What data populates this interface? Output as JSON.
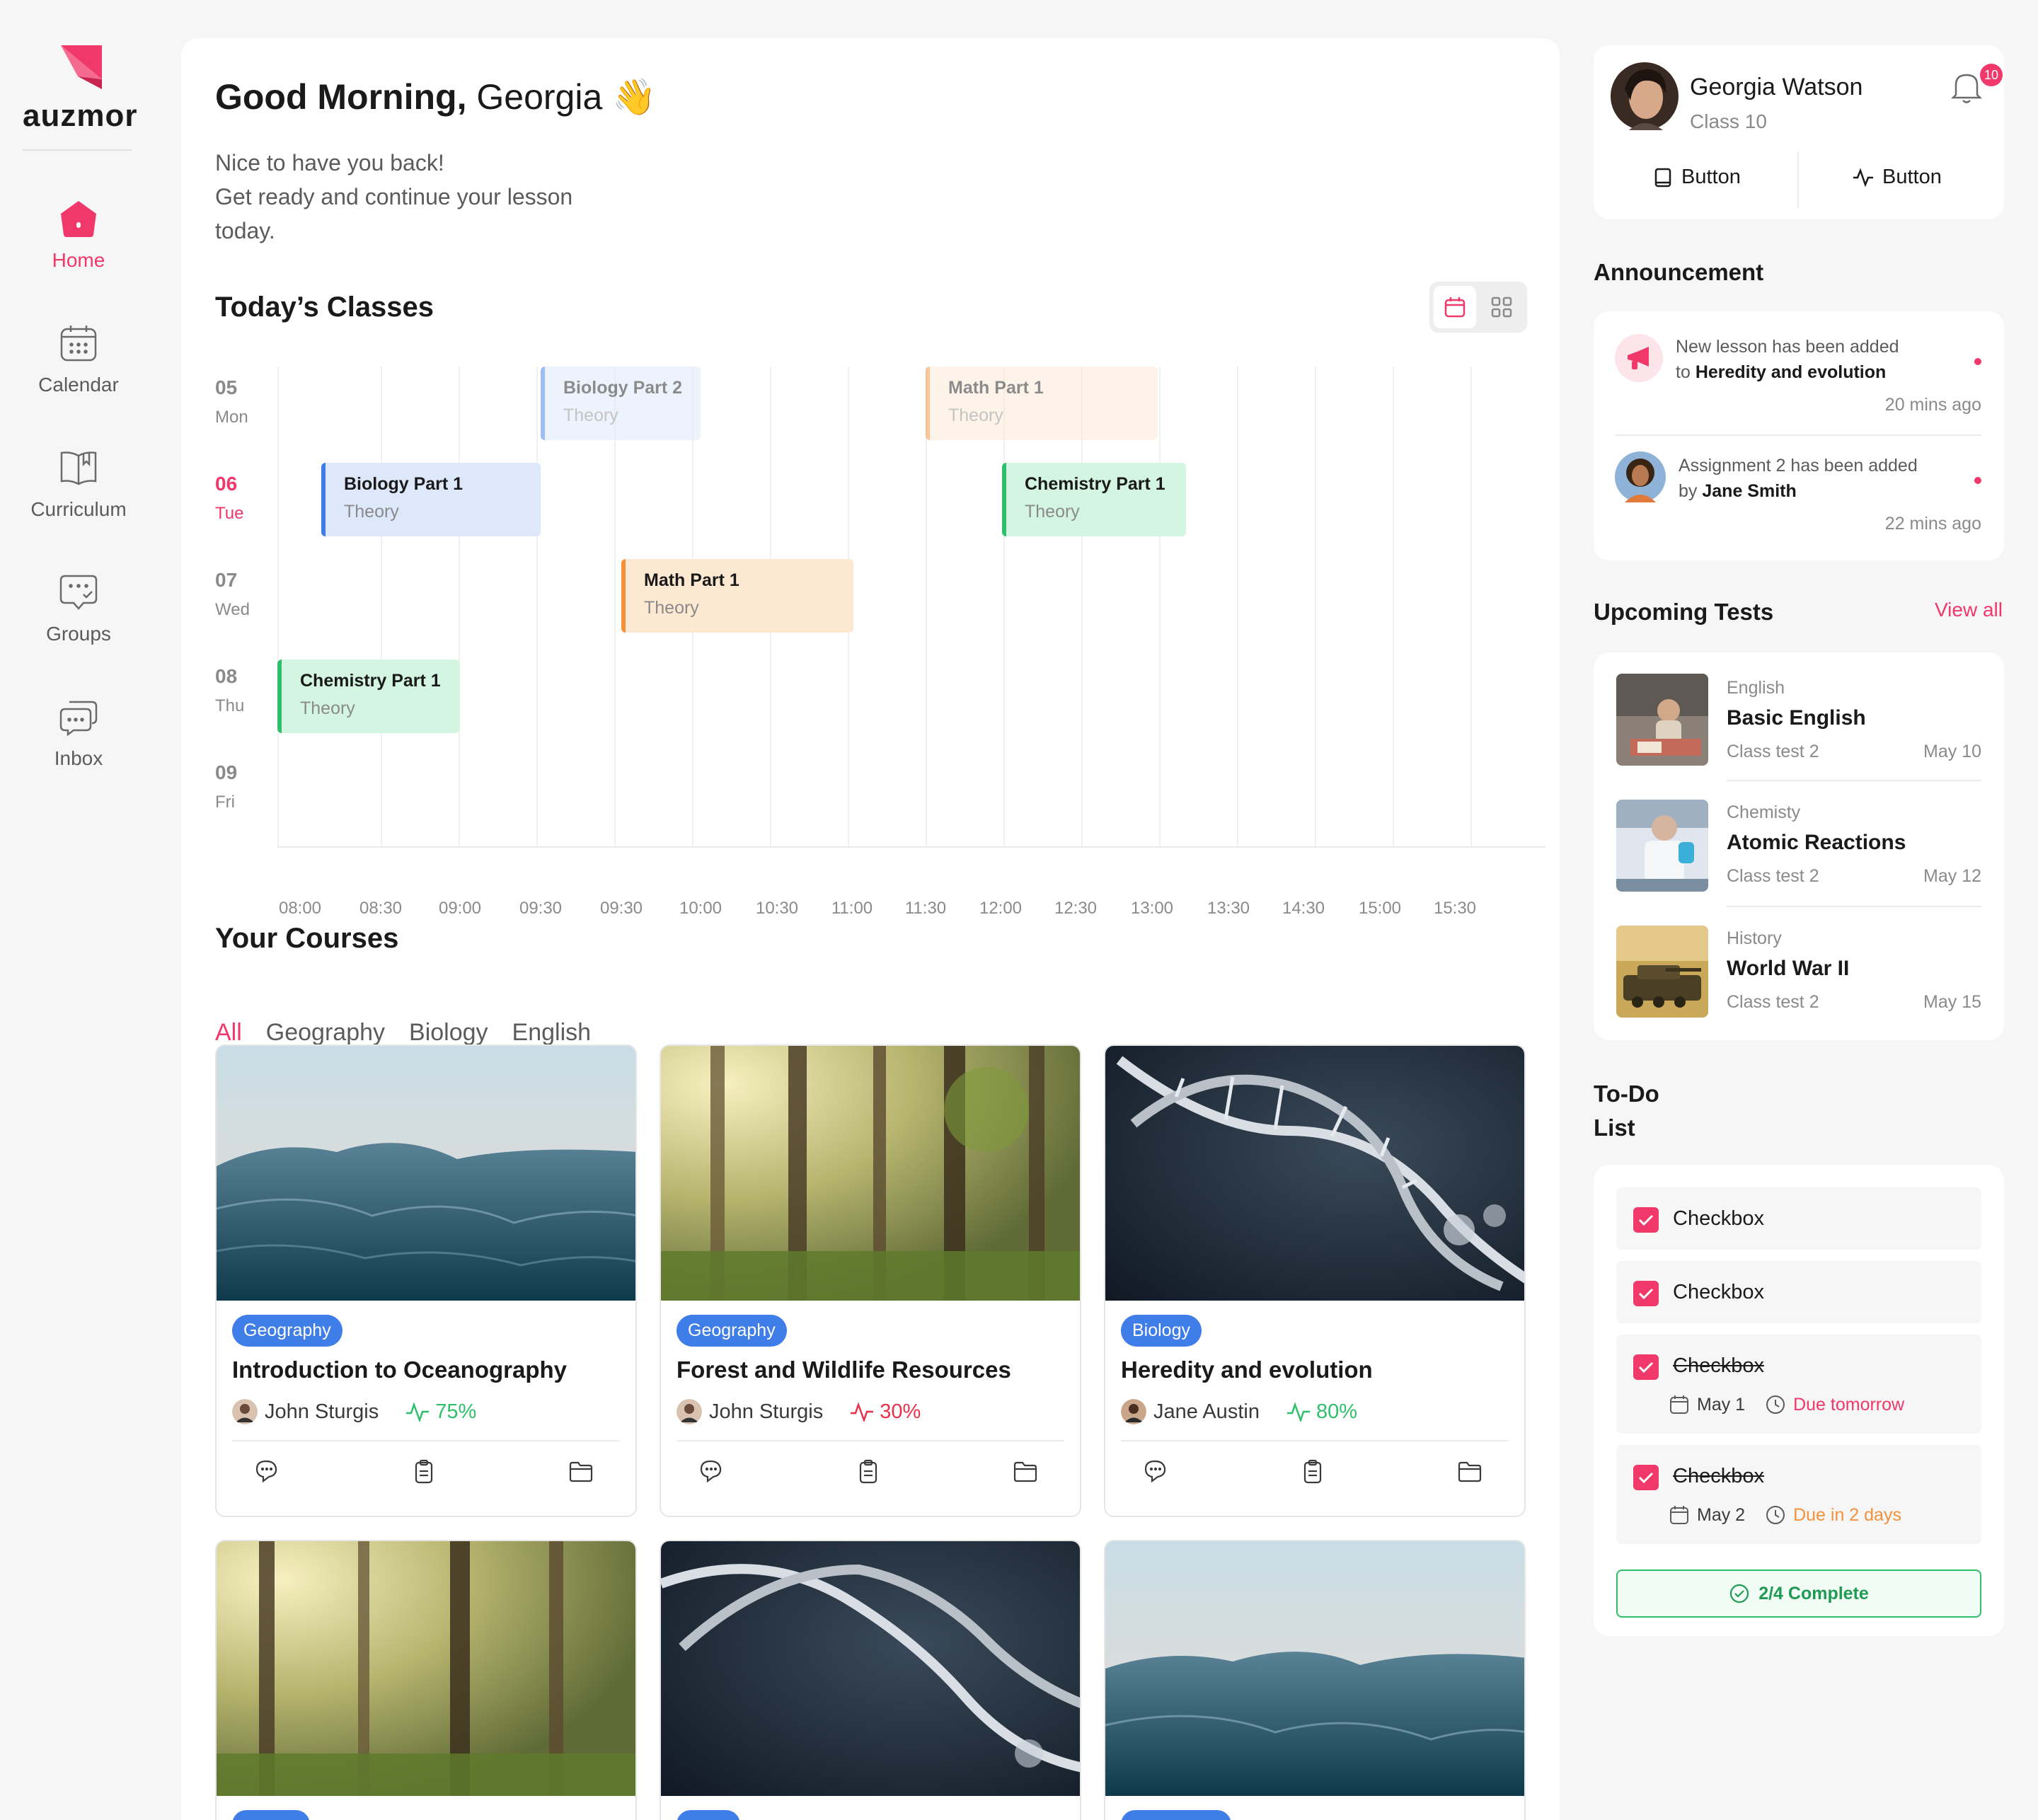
{
  "brand": {
    "name": "auzmor",
    "accent": "#f0386b"
  },
  "nav": [
    {
      "label": "Home",
      "icon": "home-icon",
      "active": true
    },
    {
      "label": "Calendar",
      "icon": "calendar-icon"
    },
    {
      "label": "Curriculum",
      "icon": "book-icon"
    },
    {
      "label": "Groups",
      "icon": "groups-icon"
    },
    {
      "label": "Inbox",
      "icon": "inbox-icon"
    }
  ],
  "greeting": {
    "prefix": "Good Morning,",
    "name": "Georgia",
    "emoji": "👋"
  },
  "subtitle": {
    "line1": "Nice to have you back!",
    "line2": "Get ready and continue your lesson today."
  },
  "today": {
    "title": "Today’s Classes",
    "days": [
      {
        "num": "05",
        "name": "Mon"
      },
      {
        "num": "06",
        "name": "Tue",
        "today": true
      },
      {
        "num": "07",
        "name": "Wed"
      },
      {
        "num": "08",
        "name": "Thu"
      },
      {
        "num": "09",
        "name": "Fri"
      }
    ],
    "times": [
      "08:00",
      "08:30",
      "09:00",
      "09:30",
      "09:30",
      "10:00",
      "10:30",
      "11:00",
      "11:30",
      "12:00",
      "12:30",
      "13:00",
      "13:30",
      "14:30",
      "15:00",
      "15:30"
    ],
    "events": [
      {
        "title": "Biology Part 2",
        "sub": "Theory",
        "color": "blue",
        "faded": true,
        "day": "Mon"
      },
      {
        "title": "Math Part 1",
        "sub": "Theory",
        "color": "orange",
        "faded": true,
        "day": "Mon"
      },
      {
        "title": "Biology Part 1",
        "sub": "Theory",
        "color": "blue",
        "day": "Tue"
      },
      {
        "title": "Chemistry Part 1",
        "sub": "Theory",
        "color": "green",
        "day": "Tue"
      },
      {
        "title": "Math Part 1",
        "sub": "Theory",
        "color": "orange",
        "day": "Wed"
      },
      {
        "title": "Chemistry Part 1",
        "sub": "Theory",
        "color": "green",
        "day": "Thu"
      }
    ]
  },
  "courses": {
    "title": "Your Courses",
    "tabs": [
      "All",
      "Geography",
      "Biology",
      "English"
    ],
    "active_tab": "All",
    "cards": [
      {
        "badge": "Geography",
        "title": "Introduction to Oceanography",
        "author": "John Sturgis",
        "progress": "75%",
        "trend": "up",
        "image": "ocean"
      },
      {
        "badge": "Geography",
        "title": "Forest and Wildlife Resources",
        "author": "John Sturgis",
        "progress": "30%",
        "trend": "down",
        "image": "forest"
      },
      {
        "badge": "Biology",
        "title": "Heredity and evolution",
        "author": "Jane Austin",
        "progress": "80%",
        "trend": "up",
        "image": "dna"
      },
      {
        "image": "forest"
      },
      {
        "image": "dna"
      },
      {
        "image": "ocean"
      }
    ]
  },
  "profile": {
    "name": "Georgia Watson",
    "class": "Class 10",
    "notifications": "10",
    "btn1": "Button",
    "btn2": "Button"
  },
  "announcement": {
    "title": "Announcement",
    "items": [
      {
        "line1": "New lesson has been added",
        "prefix": "to",
        "bold": "Heredity and evolution",
        "time": "20 mins ago"
      },
      {
        "line1": "Assignment 2 has been added",
        "prefix": "by",
        "bold": "Jane Smith",
        "time": "22 mins ago"
      }
    ]
  },
  "tests": {
    "title": "Upcoming Tests",
    "view_all": "View all",
    "items": [
      {
        "subject": "English",
        "title": "Basic English",
        "meta": "Class test 2",
        "date": "May 10"
      },
      {
        "subject": "Chemisty",
        "title": "Atomic Reactions",
        "meta": "Class test 2",
        "date": "May 12"
      },
      {
        "subject": "History",
        "title": "World War II",
        "meta": "Class test 2",
        "date": "May 15"
      }
    ]
  },
  "todo": {
    "title_line1": "To-Do",
    "title_line2": "List",
    "items": [
      {
        "label": "Checkbox",
        "done": false
      },
      {
        "label": "Checkbox",
        "done": false
      },
      {
        "label": "Checkbox",
        "done": true,
        "date": "May 1",
        "due": "Due tomorrow",
        "due_color": "#f0386b"
      },
      {
        "label": "Checkbox",
        "done": true,
        "date": "May 2",
        "due": "Due in 2 days",
        "due_color": "#f3913c"
      }
    ],
    "complete": "2/4 Complete"
  }
}
